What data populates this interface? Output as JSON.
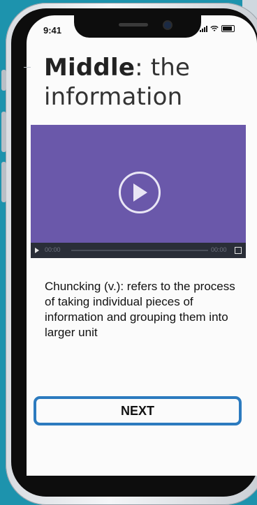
{
  "status_bar": {
    "time": "9:41"
  },
  "title": {
    "bold": "Middle",
    "rest": ": the information"
  },
  "video": {
    "current_time": "00:00",
    "duration": "00:00"
  },
  "description": "Chuncking (v.): refers to the process of taking individual pieces of information and grouping them into larger unit",
  "actions": {
    "next_label": "NEXT"
  },
  "colors": {
    "background": "#1d93ad",
    "video": "#6a58aa",
    "button_border": "#2c7bbf"
  }
}
